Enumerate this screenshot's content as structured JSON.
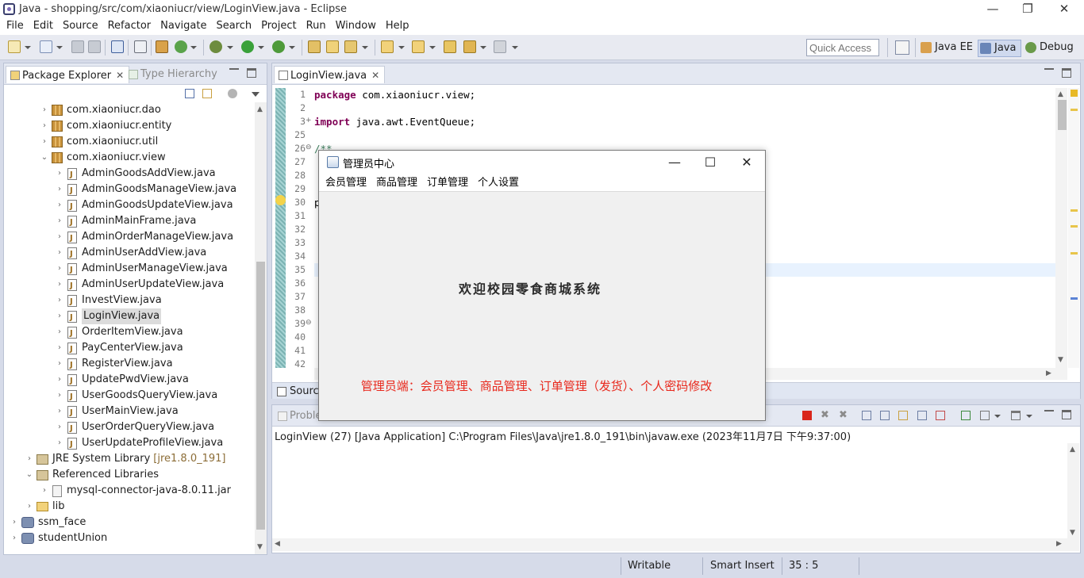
{
  "window": {
    "title": "Java - shopping/src/com/xiaoniucr/view/LoginView.java - Eclipse",
    "controls": {
      "minimize": "—",
      "restore": "❐",
      "close": "✕"
    }
  },
  "menubar": [
    "File",
    "Edit",
    "Source",
    "Refactor",
    "Navigate",
    "Search",
    "Project",
    "Run",
    "Window",
    "Help"
  ],
  "toolbar": {
    "quick_access_placeholder": "Quick Access",
    "perspectives": [
      {
        "label": "Java EE",
        "active": false
      },
      {
        "label": "Java",
        "active": true
      },
      {
        "label": "Debug",
        "active": false
      }
    ]
  },
  "left_panel": {
    "tabs": [
      {
        "label": "Package Explorer",
        "active": true
      },
      {
        "label": "Type Hierarchy",
        "active": false
      }
    ],
    "tree": [
      {
        "label": "com.xiaoniucr.dao",
        "type": "package",
        "level": 2,
        "expanded": false
      },
      {
        "label": "com.xiaoniucr.entity",
        "type": "package",
        "level": 2,
        "expanded": false
      },
      {
        "label": "com.xiaoniucr.util",
        "type": "package",
        "level": 2,
        "expanded": false
      },
      {
        "label": "com.xiaoniucr.view",
        "type": "package",
        "level": 2,
        "expanded": true
      },
      {
        "label": "AdminGoodsAddView.java",
        "type": "java",
        "level": 3
      },
      {
        "label": "AdminGoodsManageView.java",
        "type": "java",
        "level": 3
      },
      {
        "label": "AdminGoodsUpdateView.java",
        "type": "java",
        "level": 3
      },
      {
        "label": "AdminMainFrame.java",
        "type": "java",
        "level": 3
      },
      {
        "label": "AdminOrderManageView.java",
        "type": "java",
        "level": 3
      },
      {
        "label": "AdminUserAddView.java",
        "type": "java",
        "level": 3
      },
      {
        "label": "AdminUserManageView.java",
        "type": "java",
        "level": 3
      },
      {
        "label": "AdminUserUpdateView.java",
        "type": "java",
        "level": 3
      },
      {
        "label": "InvestView.java",
        "type": "java",
        "level": 3
      },
      {
        "label": "LoginView.java",
        "type": "java",
        "level": 3,
        "selected": true
      },
      {
        "label": "OrderItemView.java",
        "type": "java",
        "level": 3
      },
      {
        "label": "PayCenterView.java",
        "type": "java",
        "level": 3
      },
      {
        "label": "RegisterView.java",
        "type": "java",
        "level": 3
      },
      {
        "label": "UpdatePwdView.java",
        "type": "java",
        "level": 3
      },
      {
        "label": "UserGoodsQueryView.java",
        "type": "java",
        "level": 3
      },
      {
        "label": "UserMainView.java",
        "type": "java",
        "level": 3
      },
      {
        "label": "UserOrderQueryView.java",
        "type": "java",
        "level": 3
      },
      {
        "label": "UserUpdateProfileView.java",
        "type": "java",
        "level": 3
      },
      {
        "label": "JRE System Library",
        "suffix": "[jre1.8.0_191]",
        "type": "lib",
        "level": 1,
        "expanded": false
      },
      {
        "label": "Referenced Libraries",
        "type": "lib",
        "level": 1,
        "expanded": true
      },
      {
        "label": "mysql-connector-java-8.0.11.jar",
        "type": "jar",
        "level": 2,
        "expanded": false
      },
      {
        "label": "lib",
        "type": "folder",
        "level": 1,
        "expanded": false
      },
      {
        "label": "ssm_face",
        "type": "project",
        "level": 0,
        "expanded": false
      },
      {
        "label": "studentUnion",
        "type": "project",
        "level": 0,
        "expanded": false
      }
    ]
  },
  "editor": {
    "tab_label": "LoginView.java",
    "bottom_tab": "Sourc",
    "lines": [
      {
        "n": "1",
        "code": "package com.xiaoniucr.view;",
        "kw": "package"
      },
      {
        "n": "2",
        "code": ""
      },
      {
        "n": "3",
        "code": "import java.awt.EventQueue;",
        "kw": "import",
        "fold": "+"
      },
      {
        "n": "25",
        "code": ""
      },
      {
        "n": "26",
        "code": "/**",
        "comment": true,
        "fold": "⊖"
      },
      {
        "n": "27",
        "code": ""
      },
      {
        "n": "28",
        "code": ""
      },
      {
        "n": "29",
        "code": ""
      },
      {
        "n": "30",
        "code": "p"
      },
      {
        "n": "31",
        "code": ""
      },
      {
        "n": "32",
        "code": ""
      },
      {
        "n": "33",
        "code": ""
      },
      {
        "n": "34",
        "code": ""
      },
      {
        "n": "35",
        "code": ""
      },
      {
        "n": "36",
        "code": ""
      },
      {
        "n": "37",
        "code": ""
      },
      {
        "n": "38",
        "code": ""
      },
      {
        "n": "39",
        "code": "",
        "fold": "⊖"
      },
      {
        "n": "40",
        "code": ""
      },
      {
        "n": "41",
        "code": ""
      },
      {
        "n": "42",
        "code": ""
      }
    ]
  },
  "console": {
    "tab_label": "Proble",
    "description": "LoginView (27) [Java Application] C:\\Program Files\\Java\\jre1.8.0_191\\bin\\javaw.exe (2023年11月7日 下午9:37:00)"
  },
  "statusbar": {
    "writable": "Writable",
    "insert_mode": "Smart Insert",
    "position": "35 : 5"
  },
  "dialog": {
    "title": "管理员中心",
    "controls": {
      "minimize": "—",
      "maximize": "☐",
      "close": "✕"
    },
    "menus": [
      "会员管理",
      "商品管理",
      "订单管理",
      "个人设置"
    ],
    "welcome": "欢迎校园零食商城系统",
    "note": "管理员端：会员管理、商品管理、订单管理（发货）、个人密码修改"
  },
  "colors": {
    "note_red": "#e8281c",
    "keyword": "#7f0055",
    "comment": "#3f7f5f"
  }
}
